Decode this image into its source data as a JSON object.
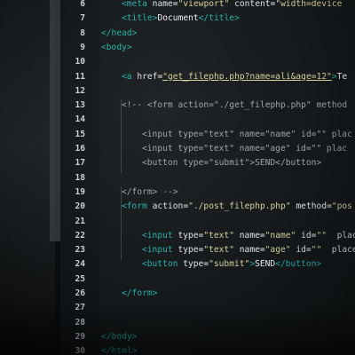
{
  "editor": {
    "lines": [
      {
        "n": "6",
        "indent": 2,
        "segs": [
          [
            "tag",
            "<"
          ],
          [
            "tag",
            "meta "
          ],
          [
            "attr",
            "name"
          ],
          [
            "txt",
            "="
          ],
          [
            "str",
            "\"viewport\""
          ],
          [
            "txt",
            " "
          ],
          [
            "attr",
            "content"
          ],
          [
            "txt",
            "="
          ],
          [
            "str",
            "\"width=device"
          ]
        ]
      },
      {
        "n": "7",
        "indent": 2,
        "segs": [
          [
            "tag",
            "<title>"
          ],
          [
            "txt",
            "Document"
          ],
          [
            "tag",
            "</title>"
          ]
        ]
      },
      {
        "n": "8",
        "indent": 0,
        "segs": [
          [
            "tag",
            "</head>"
          ]
        ]
      },
      {
        "n": "9",
        "indent": 0,
        "segs": [
          [
            "tag",
            "<body>"
          ]
        ]
      },
      {
        "n": "10",
        "indent": 0,
        "segs": []
      },
      {
        "n": "11",
        "indent": 2,
        "segs": [
          [
            "tag",
            "<a "
          ],
          [
            "attr",
            "href"
          ],
          [
            "txt",
            "="
          ],
          [
            "link",
            "\"get_filephp.php?name=ali&age=12\""
          ],
          [
            "tag",
            ">"
          ],
          [
            "txt",
            "Te"
          ]
        ]
      },
      {
        "n": "12",
        "indent": 0,
        "segs": []
      },
      {
        "n": "13",
        "indent": 2,
        "segs": [
          [
            "cm",
            "<!-- <form action=\"./get_filephp.php\" method"
          ]
        ]
      },
      {
        "n": "14",
        "indent": 0,
        "segs": []
      },
      {
        "n": "15",
        "indent": 4,
        "segs": [
          [
            "cm",
            "<input type=\"text\" name=\"name\" id=\"\" plac"
          ]
        ]
      },
      {
        "n": "16",
        "indent": 4,
        "segs": [
          [
            "cm",
            "<input type=\"text\" name=\"age\" id=\"\" plac"
          ]
        ]
      },
      {
        "n": "17",
        "indent": 4,
        "segs": [
          [
            "cm",
            "<button type=\"submit\">SEND</button>"
          ]
        ]
      },
      {
        "n": "18",
        "indent": 0,
        "segs": []
      },
      {
        "n": "19",
        "indent": 2,
        "segs": [
          [
            "cm",
            "</form> -->"
          ]
        ]
      },
      {
        "n": "20",
        "indent": 2,
        "segs": [
          [
            "tag",
            "<form "
          ],
          [
            "attr",
            "action"
          ],
          [
            "txt",
            "="
          ],
          [
            "str",
            "\"./post_filephp.php\""
          ],
          [
            "txt",
            " "
          ],
          [
            "attr",
            "method"
          ],
          [
            "txt",
            "="
          ],
          [
            "str",
            "\"pos"
          ]
        ]
      },
      {
        "n": "21",
        "indent": 0,
        "segs": []
      },
      {
        "n": "22",
        "indent": 4,
        "segs": [
          [
            "tag",
            "<input "
          ],
          [
            "attr",
            "type"
          ],
          [
            "txt",
            "="
          ],
          [
            "str",
            "\"text\""
          ],
          [
            "txt",
            " "
          ],
          [
            "attr",
            "name"
          ],
          [
            "txt",
            "="
          ],
          [
            "str",
            "\"name\""
          ],
          [
            "txt",
            " "
          ],
          [
            "attr",
            "id"
          ],
          [
            "txt",
            "="
          ],
          [
            "str",
            "\"\""
          ],
          [
            "txt",
            "  "
          ],
          [
            "attr",
            "plac"
          ]
        ]
      },
      {
        "n": "23",
        "indent": 4,
        "segs": [
          [
            "tag",
            "<input "
          ],
          [
            "attr",
            "type"
          ],
          [
            "txt",
            "="
          ],
          [
            "str",
            "\"text\""
          ],
          [
            "txt",
            " "
          ],
          [
            "attr",
            "name"
          ],
          [
            "txt",
            "="
          ],
          [
            "str",
            "\"age\""
          ],
          [
            "txt",
            " "
          ],
          [
            "attr",
            "id"
          ],
          [
            "txt",
            "="
          ],
          [
            "str",
            "\"\""
          ],
          [
            "txt",
            "  "
          ],
          [
            "attr",
            "place"
          ]
        ]
      },
      {
        "n": "24",
        "indent": 4,
        "segs": [
          [
            "tag",
            "<button "
          ],
          [
            "attr",
            "type"
          ],
          [
            "txt",
            "="
          ],
          [
            "str",
            "\"submit\""
          ],
          [
            "tag",
            ">"
          ],
          [
            "txt",
            "SEND"
          ],
          [
            "tag",
            "</button>"
          ]
        ]
      },
      {
        "n": "25",
        "indent": 0,
        "segs": []
      },
      {
        "n": "26",
        "indent": 2,
        "segs": [
          [
            "tag",
            "</form>"
          ]
        ]
      },
      {
        "n": "27",
        "indent": 0,
        "segs": []
      },
      {
        "n": "28",
        "indent": 0,
        "segs": []
      },
      {
        "n": "29",
        "indent": 0,
        "segs": [
          [
            "tag",
            "</body>"
          ]
        ]
      },
      {
        "n": "30",
        "indent": 0,
        "segs": [
          [
            "tag",
            "</html>"
          ]
        ]
      }
    ]
  }
}
